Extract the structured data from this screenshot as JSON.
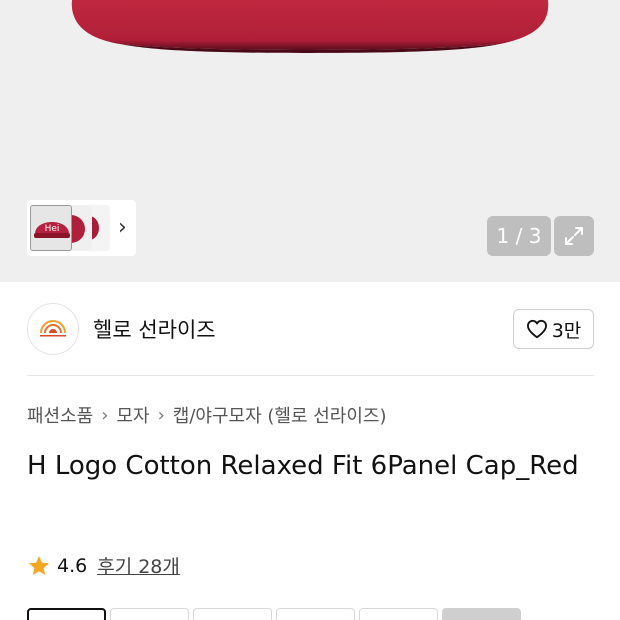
{
  "gallery": {
    "counter": "1 / 3",
    "thumbnail_chevron": "›",
    "thumbnail_text": "Hei",
    "colors": {
      "cap": "#b5213e",
      "cap_dark": "#6e0f22",
      "background": "#efefef"
    }
  },
  "brand": {
    "name": "헬로 선라이즈",
    "like_count": "3만"
  },
  "breadcrumb": [
    "패션소품",
    "모자",
    "캡/야구모자 (헬로 선라이즈)"
  ],
  "breadcrumb_sep": "›",
  "product": {
    "title": "H Logo Cotton Relaxed Fit 6Panel Cap_Red"
  },
  "rating": {
    "score": "4.6",
    "reviews_label": "후기 28개",
    "star_color": "#f5a623"
  }
}
